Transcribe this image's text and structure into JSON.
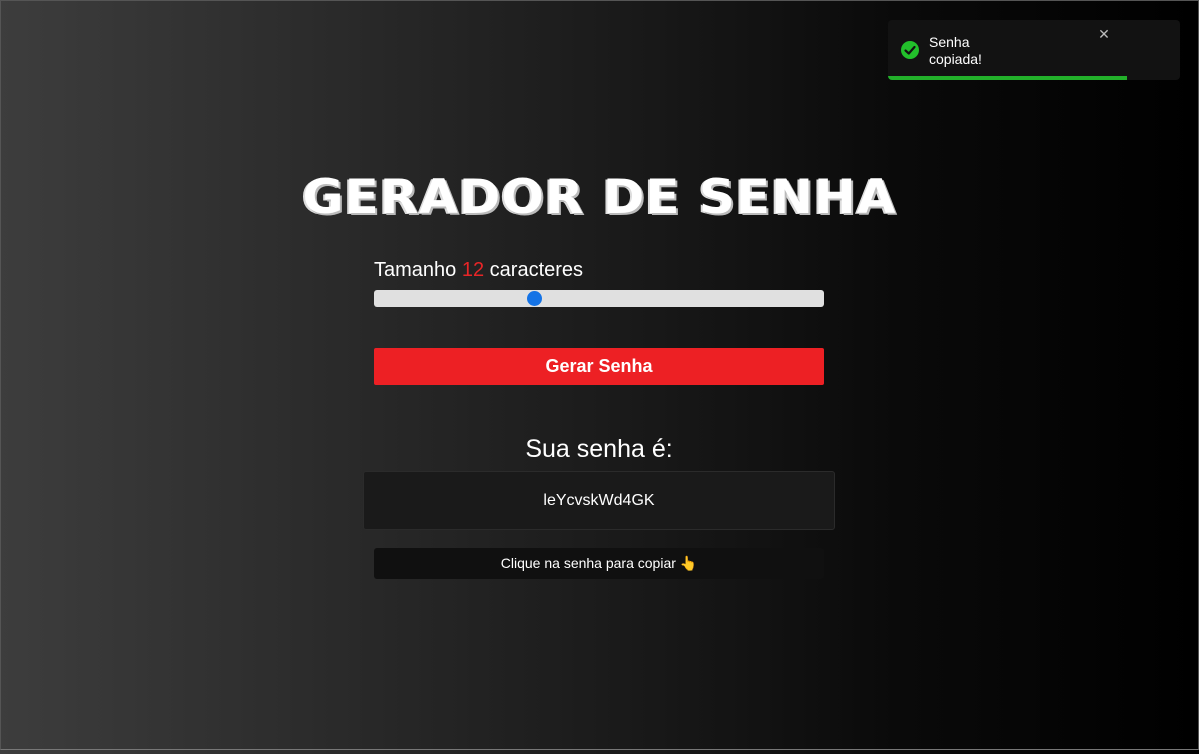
{
  "toast": {
    "message": "Senha copiada!",
    "close_symbol": "✕",
    "check_icon": "check-circle-icon",
    "progress": 0.82,
    "color": "#22c02b"
  },
  "title": "GERADOR DE SENHA",
  "length": {
    "prefix": "Tamanho",
    "value": "12",
    "suffix": "caracteres",
    "slider_fraction": 0.355,
    "accent": "#e82527"
  },
  "generate_button": {
    "label": "Gerar Senha",
    "color": "#ed2024"
  },
  "result": {
    "heading": "Sua senha é:",
    "password": "leYcvskWd4GK"
  },
  "hint": {
    "text": "Clique na senha para copiar 👆"
  }
}
